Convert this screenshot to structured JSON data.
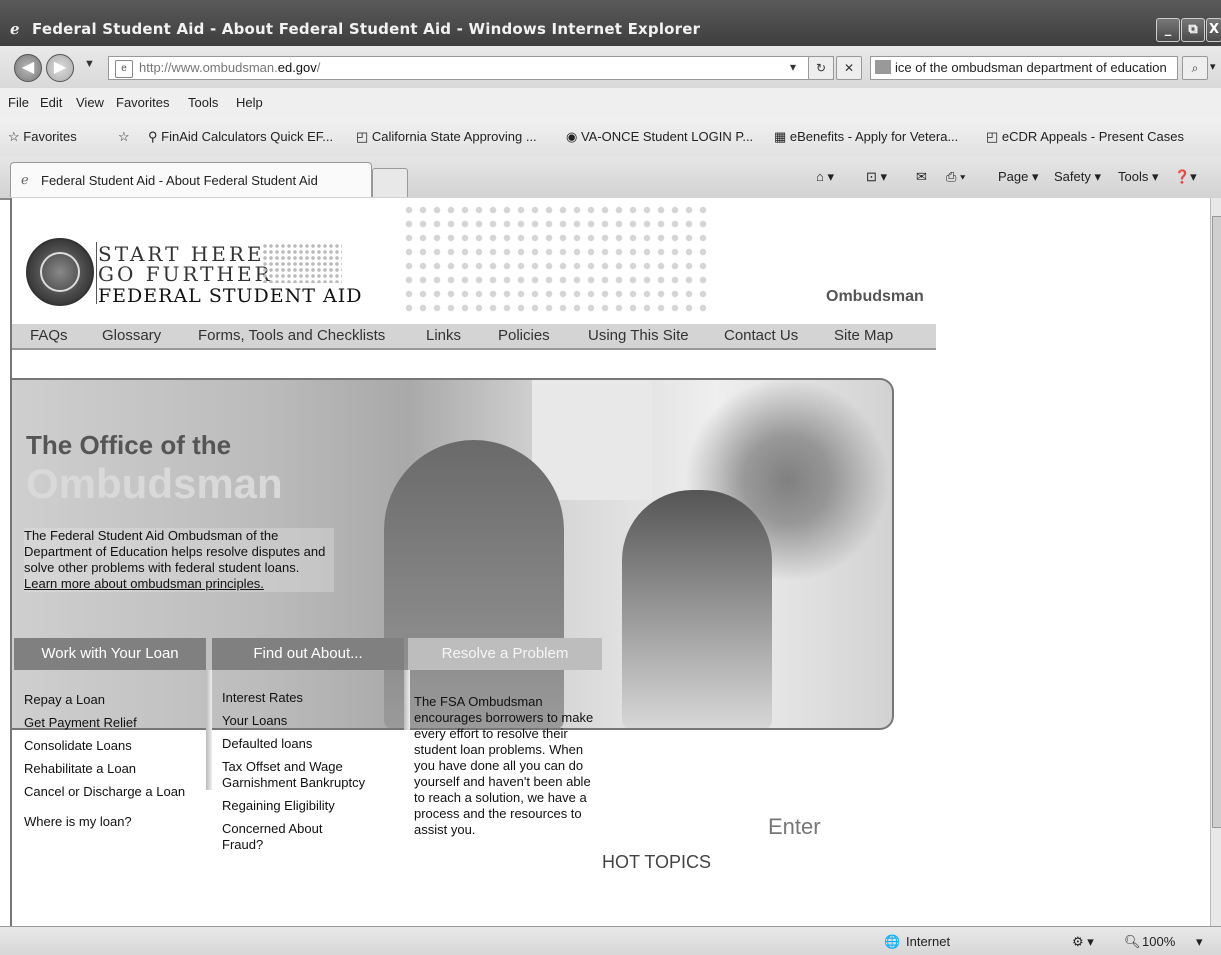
{
  "window": {
    "title": "Federal Student Aid - About Federal Student Aid - Windows Internet Explorer",
    "min": "_",
    "restore": "⧉",
    "close": "X"
  },
  "address": {
    "url_prefix": "http://www.ombudsman.",
    "url_domain": "ed.gov",
    "url_suffix": "/",
    "search_text": "ice of the ombudsman department of education"
  },
  "menu": [
    "File",
    "Edit",
    "View",
    "Favorites",
    "Tools",
    "Help"
  ],
  "favorites": {
    "label": "Favorites",
    "items": [
      "FinAid Calculators Quick EF...",
      "California State Approving ...",
      "VA-ONCE Student LOGIN P...",
      "eBenefits - Apply for Vetera...",
      "eCDR Appeals - Present Cases"
    ]
  },
  "tab": {
    "label": "Federal Student Aid - About Federal Student Aid"
  },
  "command_bar": [
    "Page ▾",
    "Safety ▾",
    "Tools ▾"
  ],
  "site": {
    "logo_line1": "START HERE",
    "logo_line2": "GO FURTHER",
    "logo_line3": "FEDERAL STUDENT AID",
    "section_label": "Ombudsman",
    "nav": [
      "FAQs",
      "Glossary",
      "Forms, Tools and Checklists",
      "Links",
      "Policies",
      "Using This Site",
      "Contact Us",
      "Site Map"
    ],
    "hero_title1": "The Office of the",
    "hero_title2": "Ombudsman",
    "hero_desc": "The Federal Student Aid Ombudsman of the Department of Education helps resolve disputes and solve other problems with federal student loans. ",
    "hero_link": "Learn more about ombudsman principles.",
    "box1_head": "Work with Your Loan",
    "box1_items": [
      "Repay a Loan",
      "Get Payment Relief",
      "Consolidate Loans",
      "Rehabilitate a Loan",
      "Cancel or Discharge a Loan",
      "Where is my loan?"
    ],
    "box2_head": "Find out About...",
    "box2_items": [
      "Interest Rates",
      "Your Loans",
      "Defaulted loans",
      "Tax Offset and Wage Garnishment Bankruptcy",
      "Regaining Eligibility",
      "Concerned About Fraud?"
    ],
    "box3_head": "Resolve a Problem",
    "box3_text": "The FSA Ombudsman encourages borrowers to make every effort to resolve their student loan problems. When you have done all you can do yourself and haven't been able to reach a solution, we have a process and the resources to assist you.",
    "enter": "Enter",
    "hot_topics": "HOT TOPICS"
  },
  "status": {
    "zone": "Internet",
    "zoom": "100%"
  }
}
